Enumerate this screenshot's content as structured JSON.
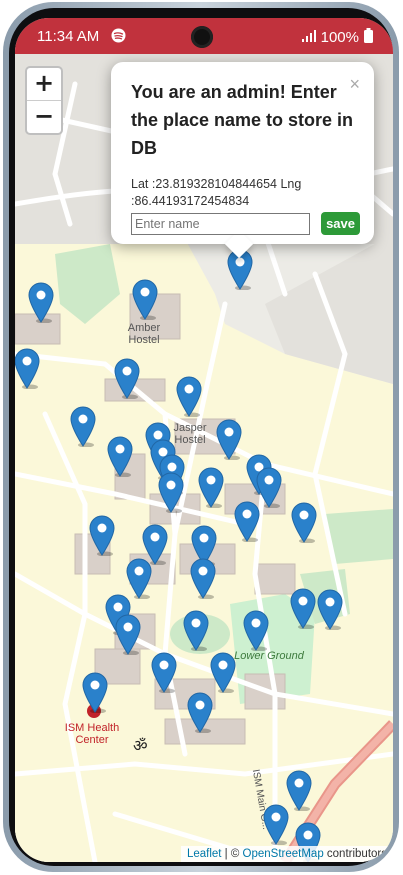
{
  "status_bar": {
    "time": "11:34 AM",
    "battery": "100%",
    "icons": [
      "spotify-icon",
      "signal-icon",
      "battery-icon"
    ]
  },
  "zoom_controls": {
    "zoom_in": "+",
    "zoom_out": "−"
  },
  "popup": {
    "title": "You are an admin! Enter the place name to store in DB",
    "coordinates": "Lat :23.819328104844654 Lng :86.44193172454834",
    "input_placeholder": "Enter name",
    "save_label": "save",
    "close_label": "×"
  },
  "map_labels": {
    "amber_hostel": "Amber Hostel",
    "jasper_hostel": "Jasper Hostel",
    "lower_ground": "Lower Ground",
    "health_center": "ISM Health Center",
    "om": "ॐ",
    "main_road": "ISM Main G..."
  },
  "attribution": {
    "leaflet": "Leaflet",
    "separator": " | © ",
    "osm": "OpenStreetMap",
    "suffix": " contributors"
  },
  "colors": {
    "status_bar": "#c1323d",
    "marker": "#2a81cb",
    "save_button": "#2d9a38",
    "campus_fill": "#fbf8d9",
    "park_green": "#c5e8c5"
  }
}
